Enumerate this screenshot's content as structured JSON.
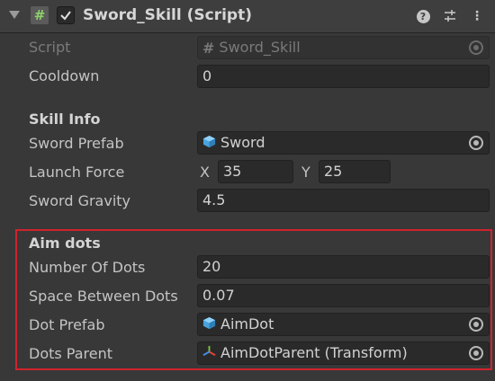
{
  "component": {
    "title": "Sword_Skill (Script)",
    "enabled": true,
    "icons": [
      "foldout-arrow-icon",
      "script-icon",
      "checkbox-check-icon",
      "help-icon",
      "presets-icon",
      "context-menu-icon"
    ]
  },
  "fields": {
    "script_label": "Script",
    "script_value": "Sword_Skill",
    "cooldown_label": "Cooldown",
    "cooldown_value": "0"
  },
  "skill_info": {
    "title": "Skill Info",
    "sword_prefab_label": "Sword Prefab",
    "sword_prefab_value": "Sword",
    "launch_force_label": "Launch Force",
    "launch_force_x_label": "X",
    "launch_force_x": "35",
    "launch_force_y_label": "Y",
    "launch_force_y": "25",
    "sword_gravity_label": "Sword Gravity",
    "sword_gravity_value": "4.5"
  },
  "aim_dots": {
    "title": "Aim dots",
    "number_of_dots_label": "Number Of Dots",
    "number_of_dots_value": "20",
    "space_between_label": "Space Between Dots",
    "space_between_value": "0.07",
    "dot_prefab_label": "Dot Prefab",
    "dot_prefab_value": "AimDot",
    "dots_parent_label": "Dots Parent",
    "dots_parent_value": "AimDotParent (Transform)"
  },
  "colors": {
    "highlight": "#d0232e",
    "background": "#383838",
    "field": "#2a2a2a"
  }
}
